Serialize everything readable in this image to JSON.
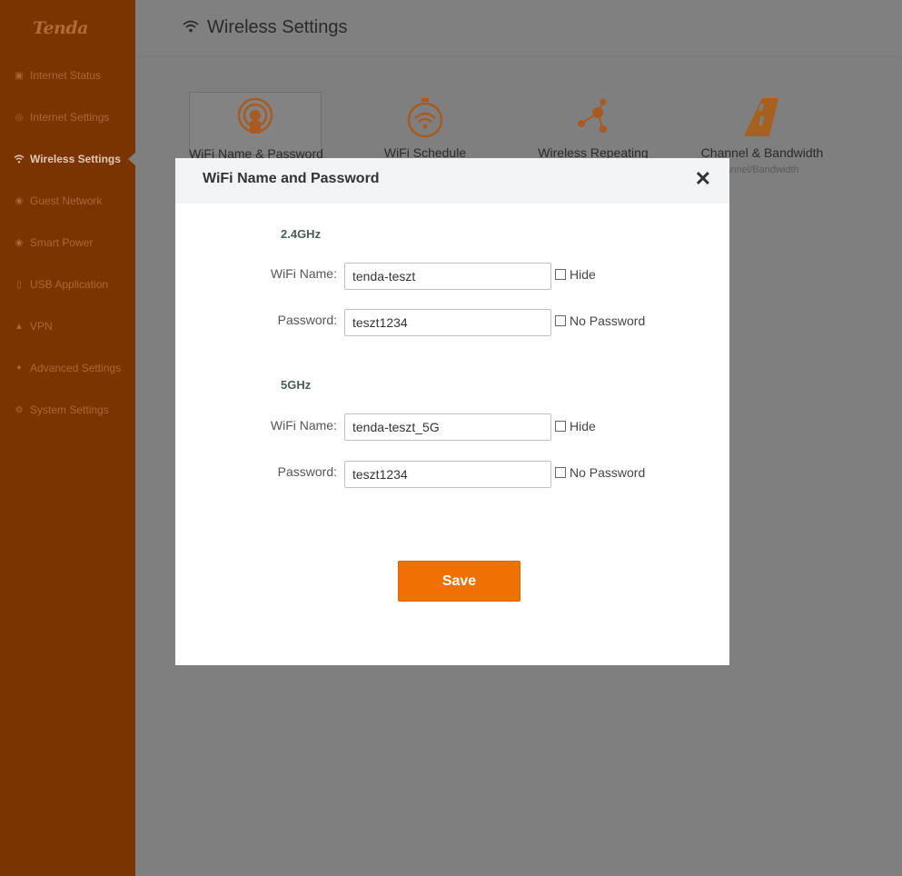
{
  "brand": {
    "logo_text": "Tenda",
    "accent": "#f07000"
  },
  "sidebar": {
    "items": [
      {
        "label": "Internet Status",
        "icon": "network-icon",
        "active": false
      },
      {
        "label": "Internet Settings",
        "icon": "globe-icon",
        "active": false
      },
      {
        "label": "Wireless Settings",
        "icon": "wifi-icon",
        "active": true
      },
      {
        "label": "Guest Network",
        "icon": "guest-icon",
        "active": false
      },
      {
        "label": "Smart Power",
        "icon": "power-icon",
        "active": false
      },
      {
        "label": "USB Application",
        "icon": "usb-icon",
        "active": false
      },
      {
        "label": "VPN",
        "icon": "vpn-icon",
        "active": false
      },
      {
        "label": "Advanced Settings",
        "icon": "wrench-icon",
        "active": false
      },
      {
        "label": "System Settings",
        "icon": "gear-icon",
        "active": false
      }
    ]
  },
  "header": {
    "title": "Wireless Settings",
    "icon": "wifi-icon"
  },
  "tiles": [
    {
      "label": "WiFi Name & Password",
      "icon": "wifi-password-icon",
      "selected": true
    },
    {
      "label": "WiFi Schedule",
      "icon": "wifi-schedule-icon",
      "selected": false
    },
    {
      "label": "Wireless Repeating",
      "icon": "repeating-icon",
      "selected": false
    },
    {
      "label": "Channel & Bandwidth",
      "sub": "annel/Bandwidth",
      "icon": "road-icon",
      "selected": false
    }
  ],
  "modal": {
    "title": "WiFi Name and Password",
    "close_icon": "close-icon",
    "band24": {
      "label": "2.4GHz",
      "name_label": "WiFi Name:",
      "name_value": "tenda-teszt",
      "hide_label": "Hide",
      "password_label": "Password:",
      "password_value": "teszt1234",
      "no_password_label": "No Password"
    },
    "band5": {
      "label": "5GHz",
      "name_label": "WiFi Name:",
      "name_value": "tenda-teszt_5G",
      "hide_label": "Hide",
      "password_label": "Password:",
      "password_value": "teszt1234",
      "no_password_label": "No Password"
    },
    "save_label": "Save"
  }
}
